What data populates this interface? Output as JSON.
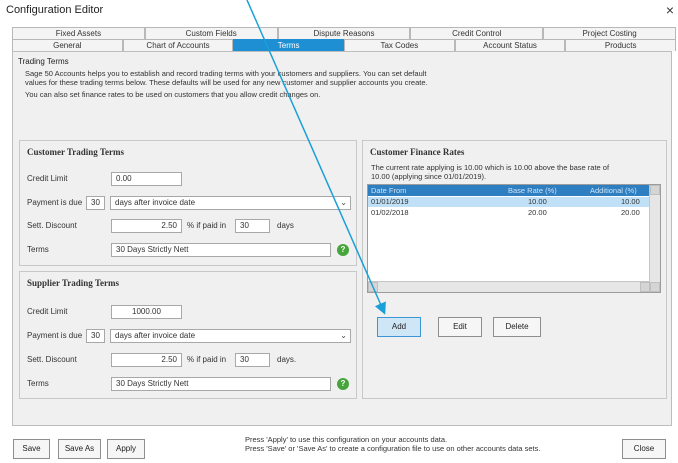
{
  "window": {
    "title": "Configuration Editor",
    "close_glyph": "×"
  },
  "tabs_row1": [
    "Fixed Assets",
    "Custom Fields",
    "Dispute Reasons",
    "Credit Control",
    "Project Costing"
  ],
  "tabs_row2": [
    "General",
    "Chart of Accounts",
    "Terms",
    "Tax Codes",
    "Account Status",
    "Products"
  ],
  "active_tab": "Terms",
  "section_title": "Trading Terms",
  "intro": {
    "line1": "Sage 50 Accounts helps you to establish and record trading terms with your customers and suppliers. You can set default",
    "line2": "values for these trading terms below. These defaults will be used for any new customer and supplier accounts you create.",
    "line3": "You can also set finance rates to be used on customers that you allow credit changes on."
  },
  "customer_terms": {
    "title": "Customer Trading Terms",
    "credit_limit_label": "Credit Limit",
    "credit_limit": "0.00",
    "payment_label": "Payment is due",
    "payment_days": "30",
    "payment_option": "days after invoice date",
    "discount_label": "Sett. Discount",
    "discount": "2.50",
    "if_paid_label": "% if paid in",
    "paid_days": "30",
    "days_label": "days",
    "terms_label": "Terms",
    "terms_value": "30 Days Strictly Nett"
  },
  "supplier_terms": {
    "title": "Supplier Trading Terms",
    "credit_limit_label": "Credit Limit",
    "credit_limit": "1000.00",
    "payment_label": "Payment is due",
    "payment_days": "30",
    "payment_option": "days after invoice date",
    "discount_label": "Sett. Discount",
    "discount": "2.50",
    "if_paid_label": "% if paid in",
    "paid_days": "30",
    "days_label": "days.",
    "terms_label": "Terms",
    "terms_value": "30 Days Strictly Nett"
  },
  "finance_rates": {
    "title": "Customer Finance Rates",
    "description_line1": "The current rate applying is 10.00 which is 10.00 above the base rate of",
    "description_line2": "10.00 (applying since 01/01/2019).",
    "columns": [
      "Date From",
      "Base Rate (%)",
      "Additional (%)"
    ],
    "rows": [
      {
        "date": "01/01/2019",
        "base": "10.00",
        "additional": "10.00"
      },
      {
        "date": "01/02/2018",
        "base": "20.00",
        "additional": "20.00"
      }
    ],
    "add_label": "Add",
    "edit_label": "Edit",
    "delete_label": "Delete"
  },
  "footer": {
    "save_label": "Save",
    "save_as_label": "Save As",
    "apply_label": "Apply",
    "note_line1": "Press 'Apply' to use this configuration on your accounts data.",
    "note_line2": "Press 'Save' or 'Save As' to create a configuration file to use on other accounts data sets.",
    "close_label": "Close"
  },
  "icons": {
    "help": "help-icon",
    "dropdown": "chevron-down-icon"
  },
  "colors": {
    "accent": "#1f8fd4",
    "grid_header": "#2e7fc2",
    "selected_row": "#bfe0f7",
    "help_green": "#46a53a"
  }
}
